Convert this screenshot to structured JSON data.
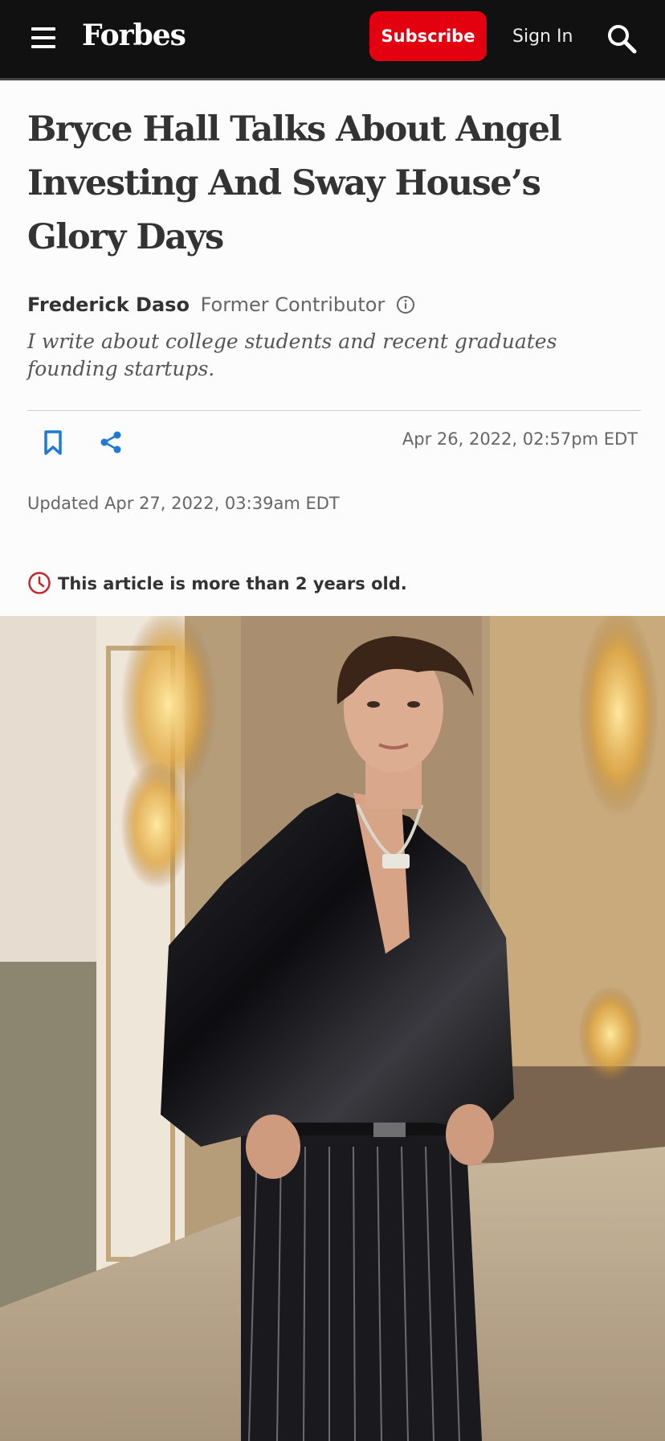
{
  "header": {
    "logo": "Forbes",
    "subscribe_label": "Subscribe",
    "signin_label": "Sign In",
    "icons": {
      "menu": "hamburger-menu-icon",
      "search": "search-icon"
    },
    "colors": {
      "bar": "#111111",
      "subscribe": "#e3000f"
    }
  },
  "article": {
    "title": "Bryce Hall Talks About Angel Investing And Sway House’s Glory Days",
    "author": "Frederick Daso",
    "author_role": "Former Contributor",
    "bio": "I write about college students and recent graduates founding startups.",
    "published": "Apr 26, 2022,  02:57pm EDT",
    "updated": "Updated Apr 27, 2022, 03:39am EDT",
    "age_notice": "This article is more than 2 years old.",
    "icons": {
      "bookmark": "bookmark-icon",
      "share": "share-icon",
      "info": "info-icon",
      "clock": "clock-icon"
    },
    "accent_color": "#1f7ad3",
    "notice_color": "#c0282d"
  },
  "hero": {
    "description_icon": "photo"
  }
}
